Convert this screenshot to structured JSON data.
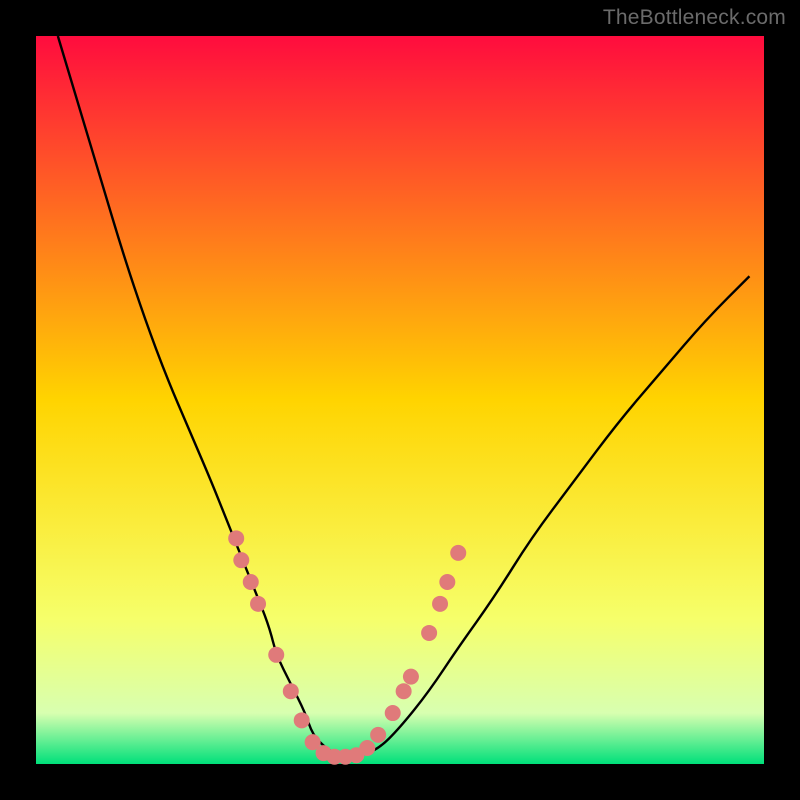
{
  "attribution": "TheBottleneck.com",
  "chart_data": {
    "type": "line",
    "title": "",
    "xlabel": "",
    "ylabel": "",
    "xlim": [
      0,
      100
    ],
    "ylim": [
      0,
      100
    ],
    "background_gradient": {
      "type": "vertical",
      "stops": [
        {
          "pos": 0.0,
          "color": "#ff0c3e"
        },
        {
          "pos": 0.5,
          "color": "#ffd400"
        },
        {
          "pos": 0.8,
          "color": "#f6ff6a"
        },
        {
          "pos": 0.93,
          "color": "#d8ffb0"
        },
        {
          "pos": 1.0,
          "color": "#00e07a"
        }
      ]
    },
    "series": [
      {
        "name": "curve",
        "color": "#000000",
        "x": [
          3,
          6,
          9,
          12,
          15,
          18,
          21,
          24,
          26,
          28,
          30,
          32,
          33,
          35,
          37,
          38,
          40,
          42,
          44,
          47,
          50,
          54,
          58,
          63,
          68,
          74,
          80,
          86,
          92,
          98
        ],
        "y": [
          100,
          90,
          80,
          70,
          61,
          53,
          46,
          39,
          34,
          29,
          24,
          19,
          15,
          11,
          7,
          4,
          2,
          1,
          1,
          2,
          5,
          10,
          16,
          23,
          31,
          39,
          47,
          54,
          61,
          67
        ]
      }
    ],
    "markers": {
      "name": "dots",
      "color": "#e07a7a",
      "radius_px": 8,
      "points": [
        {
          "x": 27.5,
          "y": 31
        },
        {
          "x": 28.2,
          "y": 28
        },
        {
          "x": 29.5,
          "y": 25
        },
        {
          "x": 30.5,
          "y": 22
        },
        {
          "x": 33.0,
          "y": 15
        },
        {
          "x": 35.0,
          "y": 10
        },
        {
          "x": 36.5,
          "y": 6
        },
        {
          "x": 38.0,
          "y": 3
        },
        {
          "x": 39.5,
          "y": 1.5
        },
        {
          "x": 41.0,
          "y": 1
        },
        {
          "x": 42.5,
          "y": 1
        },
        {
          "x": 44.0,
          "y": 1.2
        },
        {
          "x": 45.5,
          "y": 2.2
        },
        {
          "x": 47.0,
          "y": 4
        },
        {
          "x": 49.0,
          "y": 7
        },
        {
          "x": 50.5,
          "y": 10
        },
        {
          "x": 51.5,
          "y": 12
        },
        {
          "x": 54.0,
          "y": 18
        },
        {
          "x": 55.5,
          "y": 22
        },
        {
          "x": 56.5,
          "y": 25
        },
        {
          "x": 58.0,
          "y": 29
        }
      ]
    }
  }
}
